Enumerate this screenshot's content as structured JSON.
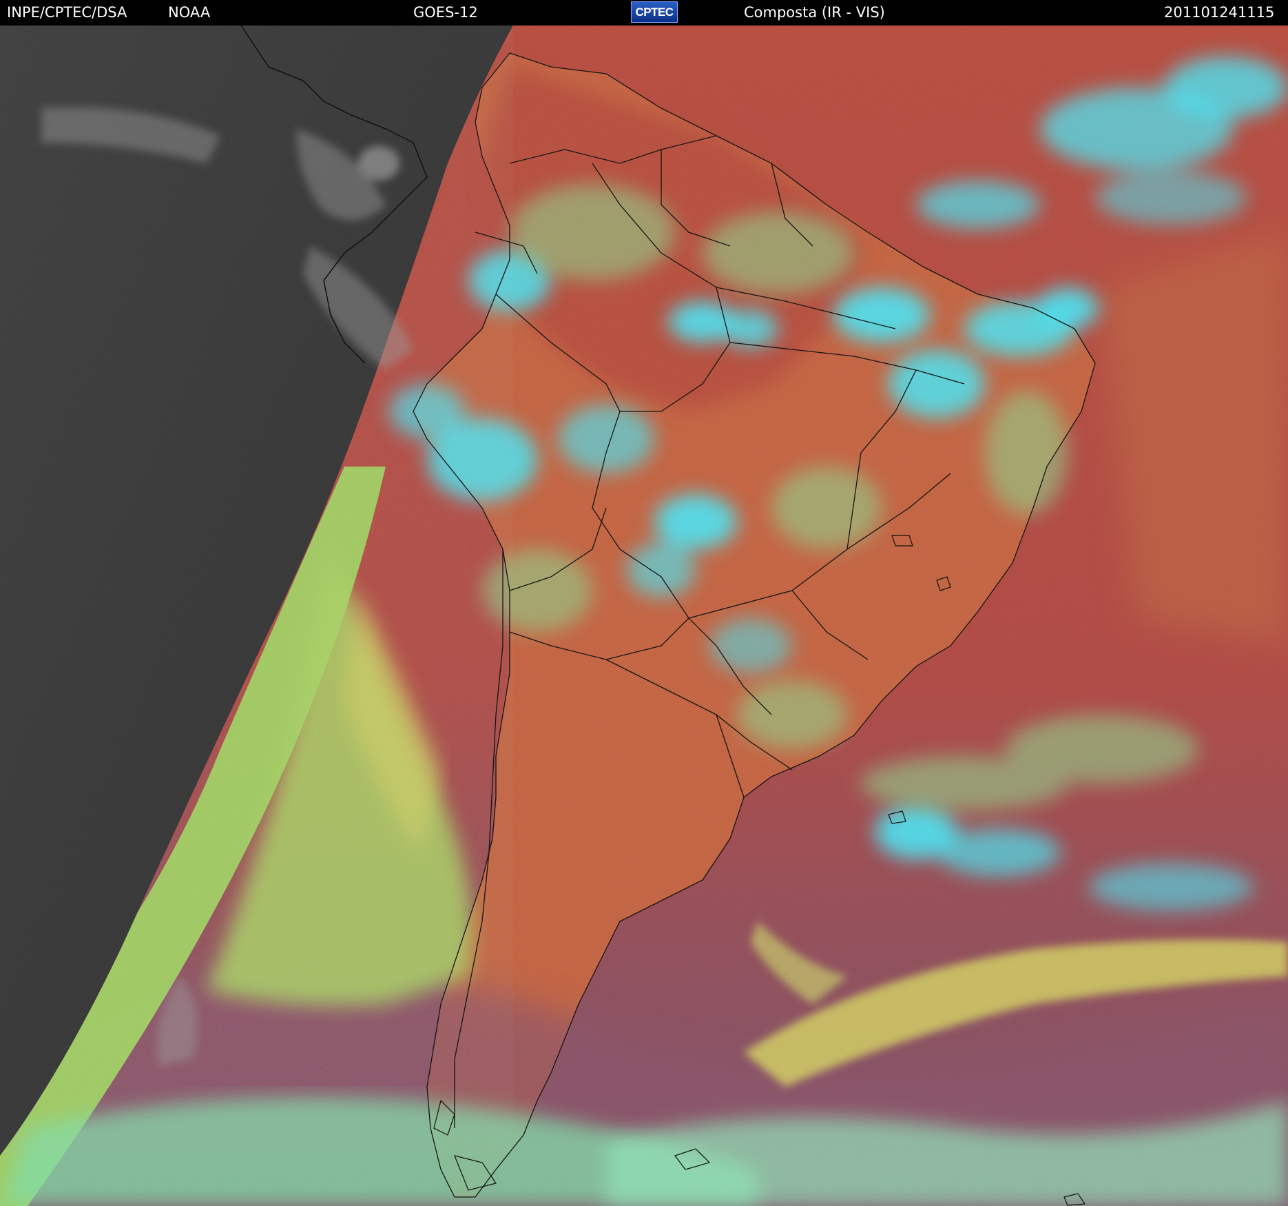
{
  "header": {
    "org": "INPE/CPTEC/DSA",
    "agency": "NOAA",
    "satellite": "GOES-12",
    "logo_text": "CPTEC",
    "product": "Composta (IR - VIS)",
    "timestamp": "201101241115"
  },
  "colors": {
    "header_bg": "#000000",
    "header_text": "#ffffff",
    "night_side": "#3a3a3a",
    "ocean_warm": "#b54a3c",
    "land_warm": "#c8603a",
    "low_cloud": "#a8d860",
    "high_cloud": "#40e8ff",
    "south_ocean": "#8a4a5c",
    "borders": "#101010"
  }
}
